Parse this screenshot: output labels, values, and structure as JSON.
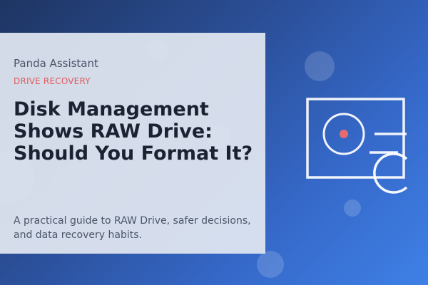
{
  "card": {
    "brand": "Panda Assistant",
    "category": "DRIVE RECOVERY",
    "title": "Disk Management Shows RAW Drive: Should You Format It?",
    "summary": "A practical guide to RAW Drive, safer decisions, and data recovery habits."
  },
  "illustration": {
    "icon": "drive-icon",
    "accent_color": "#e86b6b"
  },
  "colors": {
    "background_start": "#1e3562",
    "background_end": "#3f80e6",
    "card_background": "#e2e7f1",
    "category_color": "#e05a5a",
    "title_color": "#1b2333",
    "text_color": "#4a5568"
  }
}
